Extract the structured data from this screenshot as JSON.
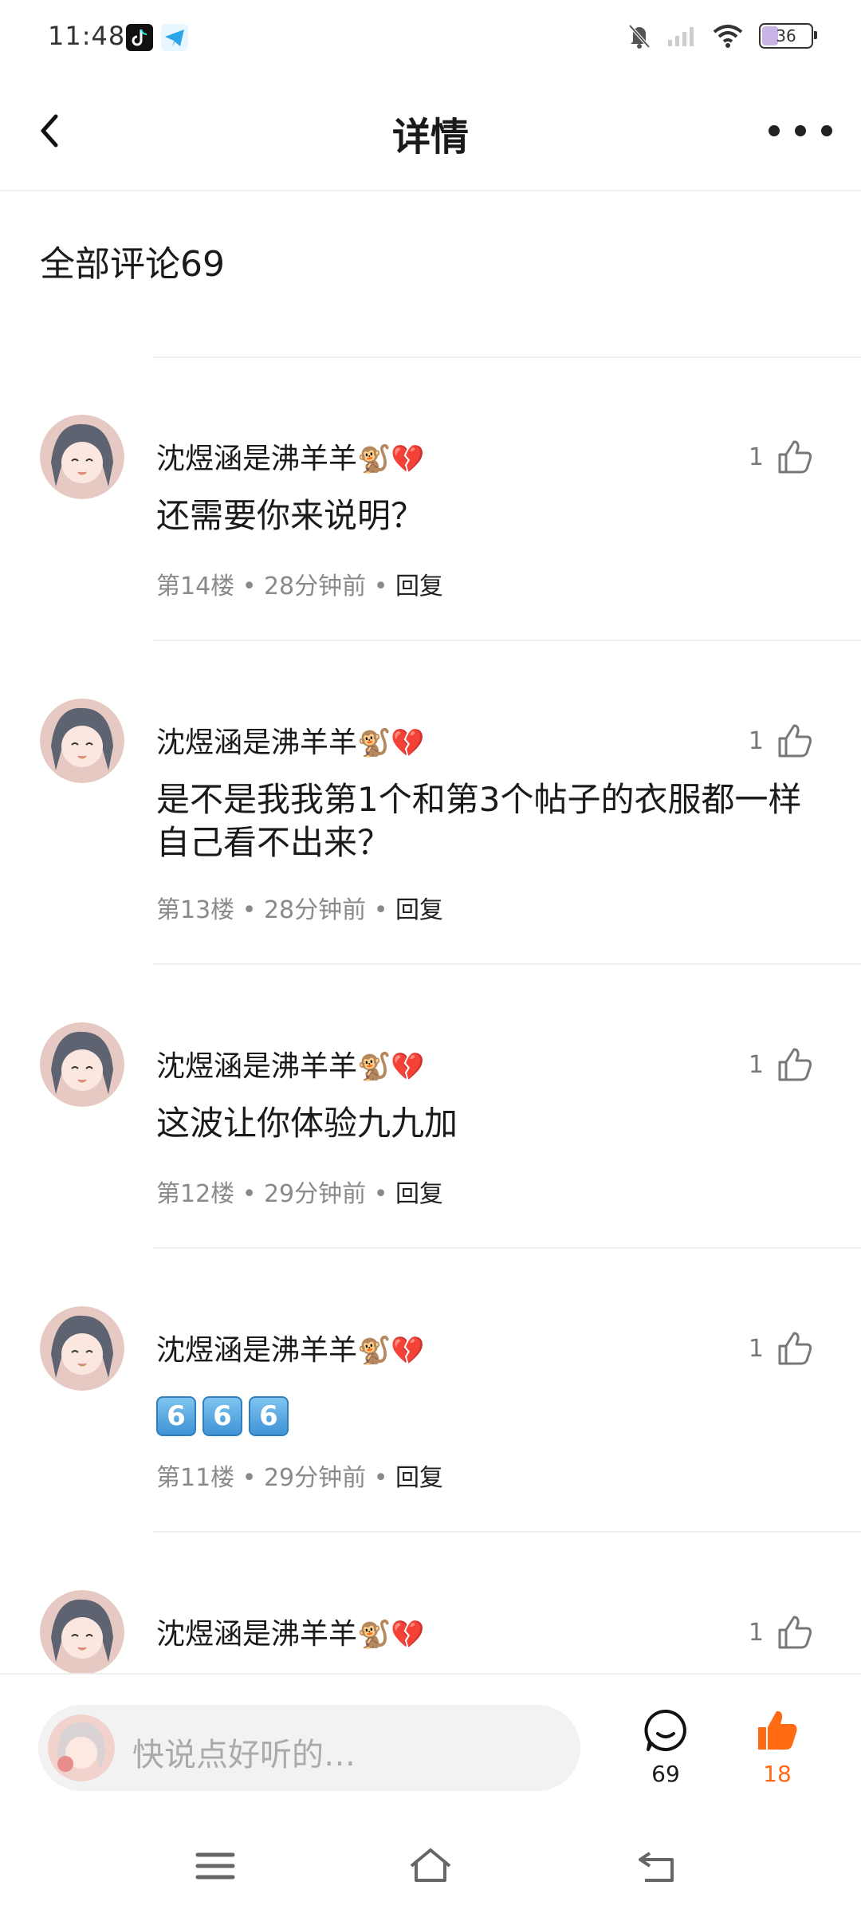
{
  "status": {
    "time": "11:48",
    "battery": "36",
    "battery_level": 0.36
  },
  "header": {
    "title": "详情"
  },
  "section": {
    "title": "全部评论69"
  },
  "comments": [
    {
      "user": "沈煜涵是沸羊羊",
      "badges": "🐒💔",
      "likes": "1",
      "text": "还需要你来说明？",
      "floor": "第14楼",
      "time": "28分钟前",
      "reply": "回复"
    },
    {
      "user": "沈煜涵是沸羊羊",
      "badges": "🐒💔",
      "likes": "1",
      "text": "是不是我我第1个和第3个帖子的衣服都一样自己看不出来？",
      "floor": "第13楼",
      "time": "28分钟前",
      "reply": "回复"
    },
    {
      "user": "沈煜涵是沸羊羊",
      "badges": "🐒💔",
      "likes": "1",
      "text": "这波让你体验九九加",
      "floor": "第12楼",
      "time": "29分钟前",
      "reply": "回复"
    },
    {
      "user": "沈煜涵是沸羊羊",
      "badges": "🐒💔",
      "likes": "1",
      "keycaps": [
        "6",
        "6",
        "6"
      ],
      "floor": "第11楼",
      "time": "29分钟前",
      "reply": "回复"
    },
    {
      "user": "沈煜涵是沸羊羊",
      "badges": "🐒💔",
      "likes": "1"
    }
  ],
  "bottom": {
    "placeholder": "快说点好听的…",
    "comment_count": "69",
    "like_count": "18",
    "accent_color": "#ff6a13"
  },
  "icons": {
    "back": "back-arrow-icon",
    "more": "more-dots-icon",
    "like": "thumbs-up-icon",
    "comment": "comment-bubble-icon"
  }
}
